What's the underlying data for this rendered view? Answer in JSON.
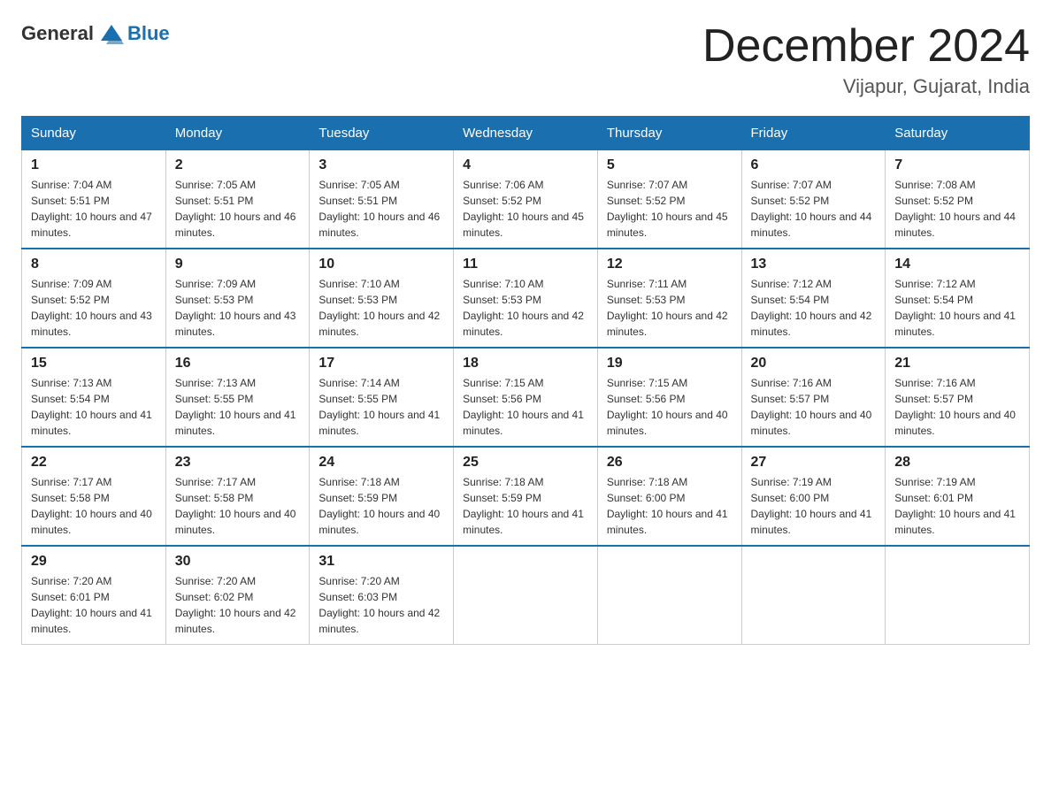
{
  "header": {
    "logo_general": "General",
    "logo_blue": "Blue",
    "month": "December 2024",
    "location": "Vijapur, Gujarat, India"
  },
  "days_of_week": [
    "Sunday",
    "Monday",
    "Tuesday",
    "Wednesday",
    "Thursday",
    "Friday",
    "Saturday"
  ],
  "weeks": [
    [
      {
        "day": "1",
        "sunrise": "7:04 AM",
        "sunset": "5:51 PM",
        "daylight": "10 hours and 47 minutes."
      },
      {
        "day": "2",
        "sunrise": "7:05 AM",
        "sunset": "5:51 PM",
        "daylight": "10 hours and 46 minutes."
      },
      {
        "day": "3",
        "sunrise": "7:05 AM",
        "sunset": "5:51 PM",
        "daylight": "10 hours and 46 minutes."
      },
      {
        "day": "4",
        "sunrise": "7:06 AM",
        "sunset": "5:52 PM",
        "daylight": "10 hours and 45 minutes."
      },
      {
        "day": "5",
        "sunrise": "7:07 AM",
        "sunset": "5:52 PM",
        "daylight": "10 hours and 45 minutes."
      },
      {
        "day": "6",
        "sunrise": "7:07 AM",
        "sunset": "5:52 PM",
        "daylight": "10 hours and 44 minutes."
      },
      {
        "day": "7",
        "sunrise": "7:08 AM",
        "sunset": "5:52 PM",
        "daylight": "10 hours and 44 minutes."
      }
    ],
    [
      {
        "day": "8",
        "sunrise": "7:09 AM",
        "sunset": "5:52 PM",
        "daylight": "10 hours and 43 minutes."
      },
      {
        "day": "9",
        "sunrise": "7:09 AM",
        "sunset": "5:53 PM",
        "daylight": "10 hours and 43 minutes."
      },
      {
        "day": "10",
        "sunrise": "7:10 AM",
        "sunset": "5:53 PM",
        "daylight": "10 hours and 42 minutes."
      },
      {
        "day": "11",
        "sunrise": "7:10 AM",
        "sunset": "5:53 PM",
        "daylight": "10 hours and 42 minutes."
      },
      {
        "day": "12",
        "sunrise": "7:11 AM",
        "sunset": "5:53 PM",
        "daylight": "10 hours and 42 minutes."
      },
      {
        "day": "13",
        "sunrise": "7:12 AM",
        "sunset": "5:54 PM",
        "daylight": "10 hours and 42 minutes."
      },
      {
        "day": "14",
        "sunrise": "7:12 AM",
        "sunset": "5:54 PM",
        "daylight": "10 hours and 41 minutes."
      }
    ],
    [
      {
        "day": "15",
        "sunrise": "7:13 AM",
        "sunset": "5:54 PM",
        "daylight": "10 hours and 41 minutes."
      },
      {
        "day": "16",
        "sunrise": "7:13 AM",
        "sunset": "5:55 PM",
        "daylight": "10 hours and 41 minutes."
      },
      {
        "day": "17",
        "sunrise": "7:14 AM",
        "sunset": "5:55 PM",
        "daylight": "10 hours and 41 minutes."
      },
      {
        "day": "18",
        "sunrise": "7:15 AM",
        "sunset": "5:56 PM",
        "daylight": "10 hours and 41 minutes."
      },
      {
        "day": "19",
        "sunrise": "7:15 AM",
        "sunset": "5:56 PM",
        "daylight": "10 hours and 40 minutes."
      },
      {
        "day": "20",
        "sunrise": "7:16 AM",
        "sunset": "5:57 PM",
        "daylight": "10 hours and 40 minutes."
      },
      {
        "day": "21",
        "sunrise": "7:16 AM",
        "sunset": "5:57 PM",
        "daylight": "10 hours and 40 minutes."
      }
    ],
    [
      {
        "day": "22",
        "sunrise": "7:17 AM",
        "sunset": "5:58 PM",
        "daylight": "10 hours and 40 minutes."
      },
      {
        "day": "23",
        "sunrise": "7:17 AM",
        "sunset": "5:58 PM",
        "daylight": "10 hours and 40 minutes."
      },
      {
        "day": "24",
        "sunrise": "7:18 AM",
        "sunset": "5:59 PM",
        "daylight": "10 hours and 40 minutes."
      },
      {
        "day": "25",
        "sunrise": "7:18 AM",
        "sunset": "5:59 PM",
        "daylight": "10 hours and 41 minutes."
      },
      {
        "day": "26",
        "sunrise": "7:18 AM",
        "sunset": "6:00 PM",
        "daylight": "10 hours and 41 minutes."
      },
      {
        "day": "27",
        "sunrise": "7:19 AM",
        "sunset": "6:00 PM",
        "daylight": "10 hours and 41 minutes."
      },
      {
        "day": "28",
        "sunrise": "7:19 AM",
        "sunset": "6:01 PM",
        "daylight": "10 hours and 41 minutes."
      }
    ],
    [
      {
        "day": "29",
        "sunrise": "7:20 AM",
        "sunset": "6:01 PM",
        "daylight": "10 hours and 41 minutes."
      },
      {
        "day": "30",
        "sunrise": "7:20 AM",
        "sunset": "6:02 PM",
        "daylight": "10 hours and 42 minutes."
      },
      {
        "day": "31",
        "sunrise": "7:20 AM",
        "sunset": "6:03 PM",
        "daylight": "10 hours and 42 minutes."
      },
      null,
      null,
      null,
      null
    ]
  ]
}
